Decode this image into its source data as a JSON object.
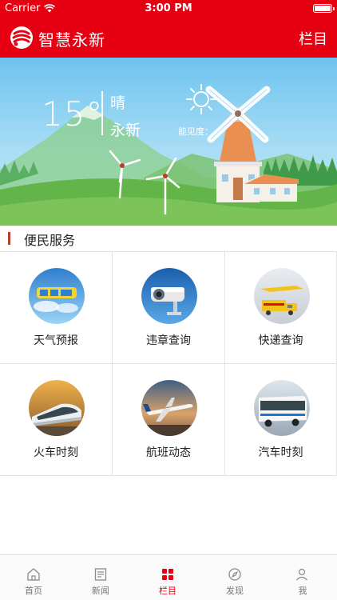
{
  "status_bar": {
    "carrier": "Carrier",
    "time": "3:00 PM"
  },
  "nav": {
    "title": "智慧永新",
    "column_button": "栏目"
  },
  "weather": {
    "temperature": "15°",
    "condition": "晴",
    "city": "永新",
    "visibility_label": "能见度："
  },
  "section": {
    "title": "便民服务"
  },
  "services": [
    {
      "label": "天气预报",
      "icon": "weather-forecast-icon"
    },
    {
      "label": "违章查询",
      "icon": "traffic-camera-icon"
    },
    {
      "label": "快递查询",
      "icon": "express-delivery-icon"
    },
    {
      "label": "火车时刻",
      "icon": "train-icon"
    },
    {
      "label": "航班动态",
      "icon": "airplane-icon"
    },
    {
      "label": "汽车时刻",
      "icon": "bus-icon"
    }
  ],
  "tabs": [
    {
      "label": "首页",
      "icon": "home-icon"
    },
    {
      "label": "新闻",
      "icon": "news-icon"
    },
    {
      "label": "栏目",
      "icon": "grid-icon"
    },
    {
      "label": "发现",
      "icon": "compass-icon"
    },
    {
      "label": "我",
      "icon": "person-icon"
    }
  ],
  "colors": {
    "brand_red": "#e60012",
    "section_bar": "#c0392b",
    "active_tab": "#e60012",
    "inactive_tab": "#777777"
  }
}
